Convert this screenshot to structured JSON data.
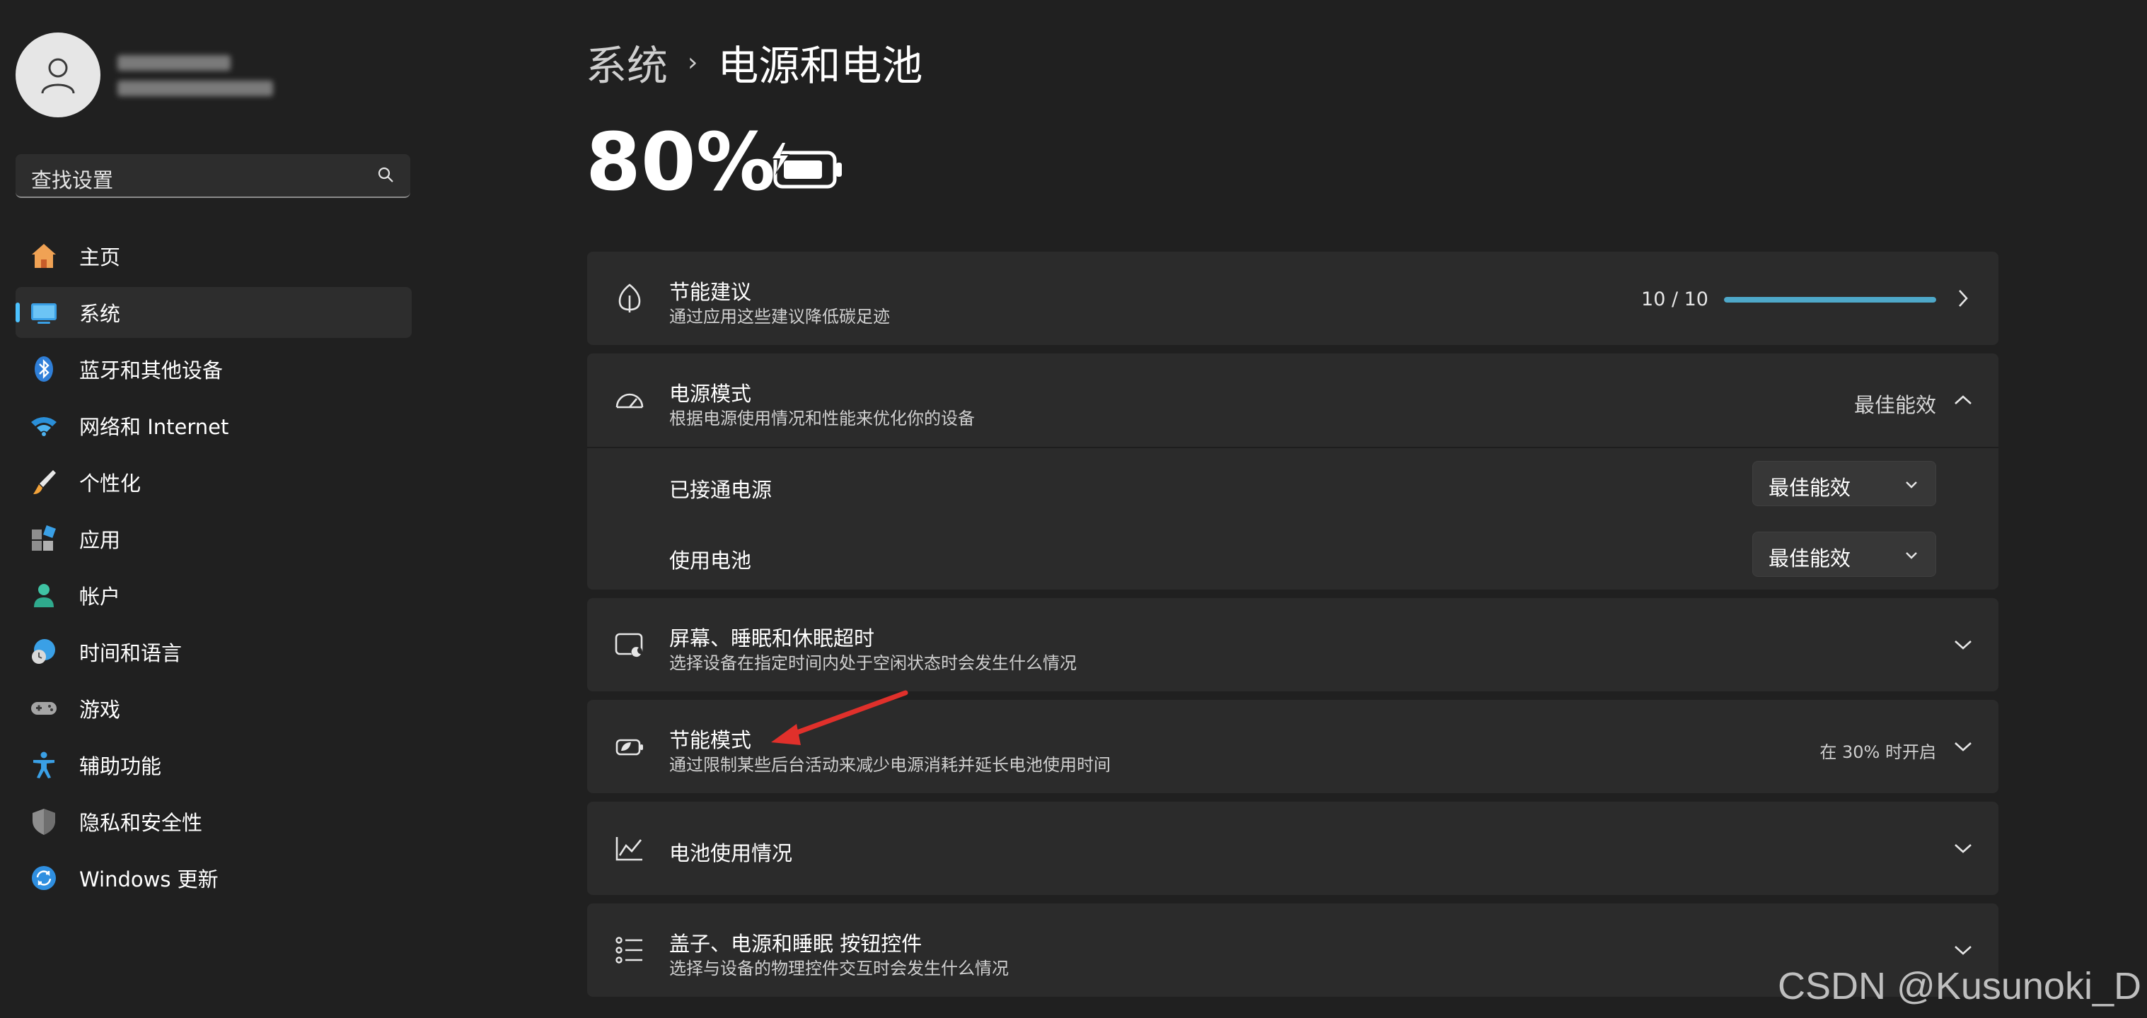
{
  "user": {
    "name": "",
    "email": ""
  },
  "search": {
    "placeholder": "查找设置"
  },
  "sidebar": {
    "items": [
      {
        "label": "主页",
        "icon": "home-icon"
      },
      {
        "label": "系统",
        "icon": "system-icon",
        "active": true
      },
      {
        "label": "蓝牙和其他设备",
        "icon": "bluetooth-icon"
      },
      {
        "label": "网络和 Internet",
        "icon": "wifi-icon"
      },
      {
        "label": "个性化",
        "icon": "brush-icon"
      },
      {
        "label": "应用",
        "icon": "apps-icon"
      },
      {
        "label": "帐户",
        "icon": "account-icon"
      },
      {
        "label": "时间和语言",
        "icon": "time-language-icon"
      },
      {
        "label": "游戏",
        "icon": "gamepad-icon"
      },
      {
        "label": "辅助功能",
        "icon": "accessibility-icon"
      },
      {
        "label": "隐私和安全性",
        "icon": "shield-icon"
      },
      {
        "label": "Windows 更新",
        "icon": "update-icon"
      }
    ]
  },
  "breadcrumb": {
    "parent": "系统",
    "separator": "›",
    "current": "电源和电池"
  },
  "battery": {
    "percent": "80%",
    "level": 0.8,
    "charging": true
  },
  "cards": {
    "energy_recommendations": {
      "title": "节能建议",
      "subtitle": "通过应用这些建议降低碳足迹",
      "score": "10 / 10",
      "progress": 1.0
    },
    "power_mode": {
      "title": "电源模式",
      "subtitle": "根据电源使用情况和性能来优化你的设备",
      "value": "最佳能效",
      "plugged_in": {
        "label": "已接通电源",
        "value": "最佳能效"
      },
      "on_battery": {
        "label": "使用电池",
        "value": "最佳能效"
      }
    },
    "screen_sleep": {
      "title": "屏幕、睡眠和休眠超时",
      "subtitle": "选择设备在指定时间内处于空闲状态时会发生什么情况"
    },
    "energy_saver": {
      "title": "节能模式",
      "subtitle": "通过限制某些后台活动来减少电源消耗并延长电池使用时间",
      "status": "在 30% 时开启"
    },
    "battery_usage": {
      "title": "电池使用情况"
    },
    "lid_power_buttons": {
      "title": "盖子、电源和睡眠 按钮控件",
      "subtitle": "选择与设备的物理控件交互时会发生什么情况"
    }
  },
  "watermark": "CSDN @Kusunoki_D",
  "colors": {
    "accent": "#4cc2ff",
    "progress": "#4ea8c9",
    "arrow": "#e0302b",
    "background": "#202020",
    "card": "#2b2b2b"
  }
}
